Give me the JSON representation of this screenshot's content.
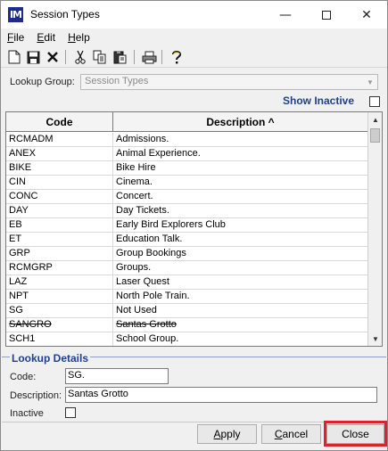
{
  "window": {
    "app_icon_text": "IM",
    "title": "Session Types",
    "minimize_glyph": "—",
    "close_glyph": "✕"
  },
  "menu": [
    {
      "pre": "",
      "u": "F",
      "post": "ile"
    },
    {
      "pre": "",
      "u": "E",
      "post": "dit"
    },
    {
      "pre": "",
      "u": "H",
      "post": "elp"
    }
  ],
  "toolbar_icons": [
    "new-icon",
    "save-icon",
    "delete-icon",
    "cut-icon",
    "copy-icon",
    "paste-icon",
    "print-icon",
    "help-icon"
  ],
  "lookup_group": {
    "label": "Lookup Group:",
    "value": "Session Types"
  },
  "show_inactive": {
    "label": "Show Inactive",
    "checked": false
  },
  "grid": {
    "columns": {
      "code": "Code",
      "description": "Description ^"
    },
    "rows": [
      {
        "code": "RCMADM",
        "description": "Admissions.",
        "inactive": false
      },
      {
        "code": "ANEX",
        "description": "Animal Experience.",
        "inactive": false
      },
      {
        "code": "BIKE",
        "description": "Bike Hire",
        "inactive": false
      },
      {
        "code": "CIN",
        "description": "Cinema.",
        "inactive": false
      },
      {
        "code": "CONC",
        "description": "Concert.",
        "inactive": false
      },
      {
        "code": "DAY",
        "description": "Day Tickets.",
        "inactive": false
      },
      {
        "code": "EB",
        "description": "Early Bird Explorers Club",
        "inactive": false
      },
      {
        "code": "ET",
        "description": "Education Talk.",
        "inactive": false
      },
      {
        "code": "GRP",
        "description": "Group Bookings",
        "inactive": false
      },
      {
        "code": "RCMGRP",
        "description": "Groups.",
        "inactive": false
      },
      {
        "code": "LAZ",
        "description": "Laser Quest",
        "inactive": false
      },
      {
        "code": "NPT",
        "description": "North Pole Train.",
        "inactive": false
      },
      {
        "code": "SG",
        "description": "Not Used",
        "inactive": false
      },
      {
        "code": "SANGRO",
        "description": "Santas Grotto",
        "inactive": true
      },
      {
        "code": "SCH1",
        "description": "School Group.",
        "inactive": false
      }
    ]
  },
  "details": {
    "title": "Lookup Details",
    "code_label": "Code:",
    "code_value": "SG.",
    "description_label": "Description:",
    "description_value": "Santas Grotto",
    "inactive_label": "Inactive",
    "inactive_checked": false
  },
  "buttons": {
    "apply": {
      "u": "A",
      "post": "pply"
    },
    "cancel": {
      "u": "C",
      "post": "ancel"
    },
    "close": "Close"
  },
  "colors": {
    "accent_blue": "#1f3f8f",
    "highlight_red": "#e0202a",
    "app_icon_bg": "#1e2a8c"
  }
}
